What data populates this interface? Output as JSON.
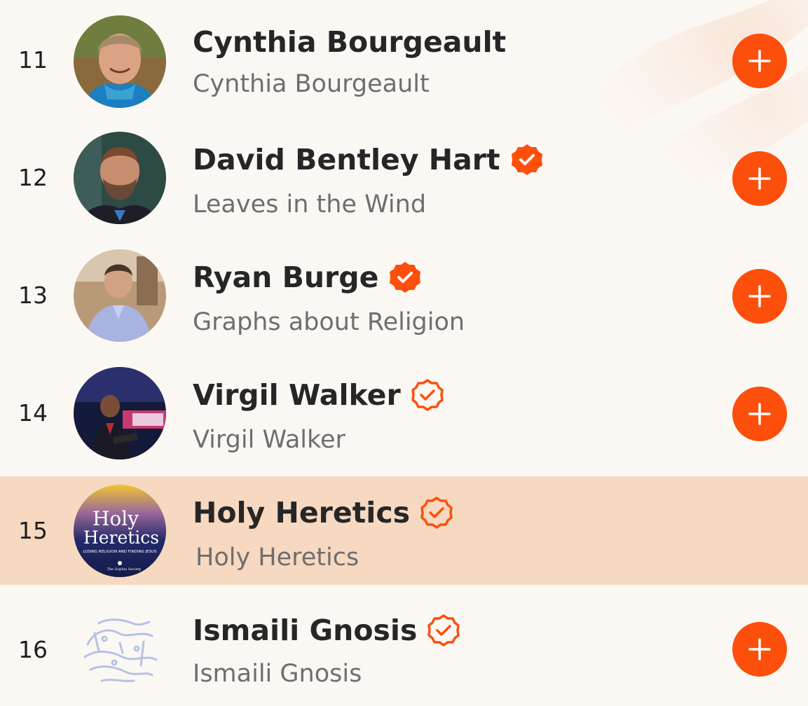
{
  "colors": {
    "accent": "#fd4f0c",
    "highlight_row": "#f7d8c0",
    "background": "#fbf8f4"
  },
  "items": [
    {
      "rank": "11",
      "title": "Cynthia Bourgeault",
      "subtitle": "Cynthia Bourgeault",
      "verified": "none",
      "avatar": "portrait-photo",
      "add_icon": "plus-icon"
    },
    {
      "rank": "12",
      "title": "David Bentley Hart",
      "subtitle": "Leaves in the Wind",
      "verified": "filled",
      "avatar": "portrait-photo",
      "add_icon": "plus-icon"
    },
    {
      "rank": "13",
      "title": "Ryan Burge",
      "subtitle": "Graphs about Religion",
      "verified": "filled",
      "avatar": "portrait-photo",
      "add_icon": "plus-icon"
    },
    {
      "rank": "14",
      "title": "Virgil Walker",
      "subtitle": "Virgil Walker",
      "verified": "outline",
      "avatar": "stage-photo",
      "add_icon": "plus-icon"
    },
    {
      "rank": "15",
      "title": "Holy Heretics",
      "subtitle": "Holy Heretics",
      "verified": "outline",
      "avatar": "podcast-cover",
      "avatar_text": {
        "line1": "Holy",
        "line2": "Heretics",
        "tagline": "LOSING RELIGION AND FINDING JESUS",
        "publisher": "The Sophia Society"
      },
      "highlighted": true
    },
    {
      "rank": "16",
      "title": "Ismaili Gnosis",
      "subtitle": "Ismaili Gnosis",
      "verified": "outline",
      "avatar": "calligraphy-logo",
      "add_icon": "plus-icon"
    }
  ]
}
